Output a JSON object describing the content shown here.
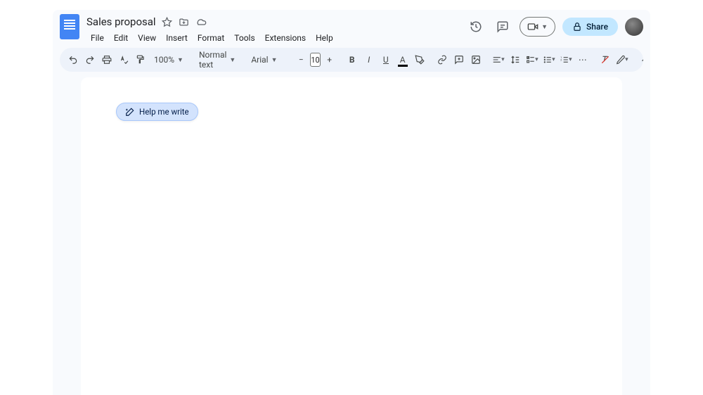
{
  "doc": {
    "title": "Sales proposal"
  },
  "menu": {
    "file": "File",
    "edit": "Edit",
    "view": "View",
    "insert": "Insert",
    "format": "Format",
    "tools": "Tools",
    "extensions": "Extensions",
    "help": "Help"
  },
  "header": {
    "share_label": "Share"
  },
  "toolbar": {
    "zoom": "100%",
    "style": "Normal text",
    "font": "Arial",
    "font_size": "10"
  },
  "chip": {
    "help_write": "Help me write"
  }
}
